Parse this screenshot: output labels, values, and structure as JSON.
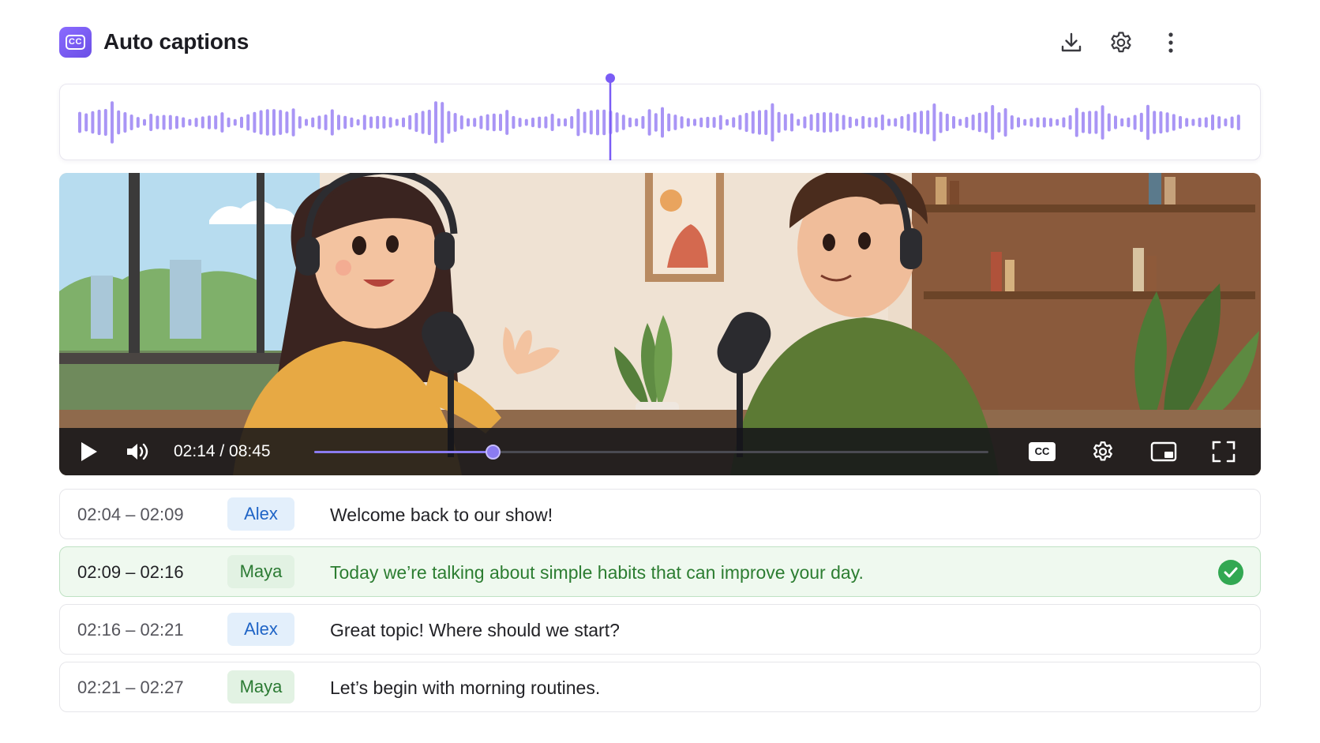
{
  "app": {
    "title": "Auto captions",
    "logo_icon": "closed-captions-icon",
    "logo_text": "CC",
    "accent": "#7a5cf5"
  },
  "header_actions": [
    {
      "name": "download-icon"
    },
    {
      "name": "gear-icon"
    },
    {
      "name": "more-vertical-icon"
    }
  ],
  "waveform": {
    "color": "#a995f5",
    "playhead_color": "#7a5cf5"
  },
  "player": {
    "current_time": "02:14",
    "duration": "08:45",
    "time_display": "02:14 / 08:45",
    "progress": 0.2648,
    "cc_label": "CC",
    "controls": [
      "play-icon",
      "volume-icon",
      "cc-icon",
      "gear-icon",
      "miniplayer-icon",
      "fullscreen-icon"
    ]
  },
  "captions": [
    {
      "range": "02:04 – 02:09",
      "speaker": "Alex",
      "text": "Welcome back to our show!",
      "active": false
    },
    {
      "range": "02:09 – 02:16",
      "speaker": "Maya",
      "text": "Today we’re talking about simple habits that can improve your day.",
      "active": true
    },
    {
      "range": "02:16 – 02:21",
      "speaker": "Alex",
      "text": "Great topic! Where should we start?",
      "active": false
    },
    {
      "range": "02:21 – 02:27",
      "speaker": "Maya",
      "text": "Let’s begin with morning routines.",
      "active": false
    }
  ],
  "colors": {
    "alex_chip_bg": "#e3effb",
    "alex_chip_text": "#1f64c6",
    "maya_chip_bg": "#e2f2e3",
    "maya_chip_text": "#2b7a33",
    "active_row_bg": "#eff9ef",
    "active_text": "#2c7d31",
    "check": "#32a852"
  }
}
